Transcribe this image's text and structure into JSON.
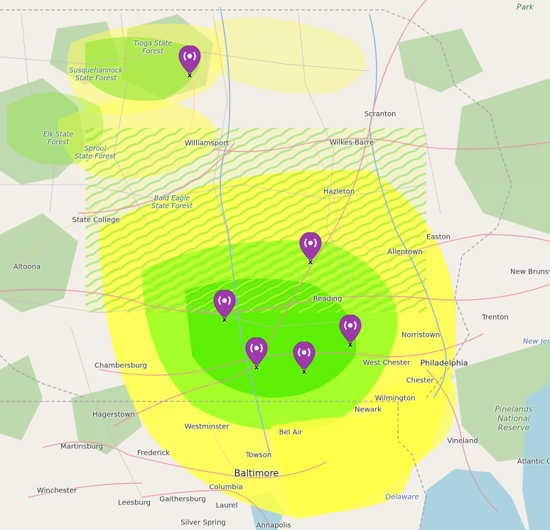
{
  "map": {
    "cities": [
      {
        "id": "scranton",
        "name": "Scranton"
      },
      {
        "id": "wilkes-barre",
        "name": "Wilkes-Barre"
      },
      {
        "id": "williamsport",
        "name": "Williamsport"
      },
      {
        "id": "hazleton",
        "name": "Hazleton"
      },
      {
        "id": "state-college",
        "name": "State College"
      },
      {
        "id": "altoona",
        "name": "Altoona"
      },
      {
        "id": "easton",
        "name": "Easton"
      },
      {
        "id": "allentown",
        "name": "Allentown"
      },
      {
        "id": "new-brunswick",
        "name": "New Brunsv"
      },
      {
        "id": "trenton",
        "name": "Trenton"
      },
      {
        "id": "norristown",
        "name": "Norristown"
      },
      {
        "id": "philadelphia",
        "name": "Philadelphia"
      },
      {
        "id": "west-chester",
        "name": "West Chester"
      },
      {
        "id": "chester",
        "name": "Chester"
      },
      {
        "id": "wilmington",
        "name": "Wilmington"
      },
      {
        "id": "newark",
        "name": "Newark"
      },
      {
        "id": "chambersburg",
        "name": "Chambersburg"
      },
      {
        "id": "hagerstown",
        "name": "Hagerstown"
      },
      {
        "id": "martinsburg",
        "name": "Martinsburg"
      },
      {
        "id": "frederick",
        "name": "Frederick"
      },
      {
        "id": "westminster",
        "name": "Westminster"
      },
      {
        "id": "bel-air",
        "name": "Bel Air"
      },
      {
        "id": "towson",
        "name": "Towson"
      },
      {
        "id": "baltimore",
        "name": "Baltimore"
      },
      {
        "id": "columbia",
        "name": "Columbia"
      },
      {
        "id": "laurel",
        "name": "Laurel"
      },
      {
        "id": "gaithersburg",
        "name": "Gaithersburg"
      },
      {
        "id": "leesburg",
        "name": "Leesburg"
      },
      {
        "id": "winchester",
        "name": "Winchester"
      },
      {
        "id": "silver-spring",
        "name": "Silver Spring"
      },
      {
        "id": "annapolis",
        "name": "Annapolis"
      },
      {
        "id": "vineland",
        "name": "Vineland"
      },
      {
        "id": "atlantic-city",
        "name": "Atlantic C"
      },
      {
        "id": "reading",
        "name": "Reading"
      }
    ],
    "forests": [
      {
        "id": "tioga",
        "name": "Tioga State\nForest"
      },
      {
        "id": "susquehannock",
        "name": "Susquehannock\nState Forest"
      },
      {
        "id": "elk",
        "name": "Elk State\nForest"
      },
      {
        "id": "sproul",
        "name": "Sproul\nState Forest"
      },
      {
        "id": "bald-eagle",
        "name": "Bald Eagle\nState Forest"
      },
      {
        "id": "pinelands",
        "name": "Pinelands\nNational\nReserve"
      },
      {
        "id": "park",
        "name": "Park"
      }
    ],
    "water": [
      {
        "id": "delaware",
        "name": "Delaware"
      },
      {
        "id": "new-jersey",
        "name": "New Jer"
      }
    ],
    "markers": [
      {
        "id": "m1",
        "tag": "x"
      },
      {
        "id": "m2",
        "tag": "x"
      },
      {
        "id": "m3",
        "tag": "x"
      },
      {
        "id": "m4",
        "tag": "x"
      },
      {
        "id": "m5",
        "tag": "x"
      },
      {
        "id": "m6",
        "tag": "x"
      }
    ],
    "colors": {
      "land": "#f2efe9",
      "forest": "#add19e",
      "coverage_strong": "#55ee00",
      "coverage_mid": "#aaff22",
      "coverage_weak": "#ffff44",
      "water": "#aad3df",
      "marker": "#9b3aa8",
      "road_major": "#e892a2",
      "border": "#9e9e9e"
    }
  }
}
